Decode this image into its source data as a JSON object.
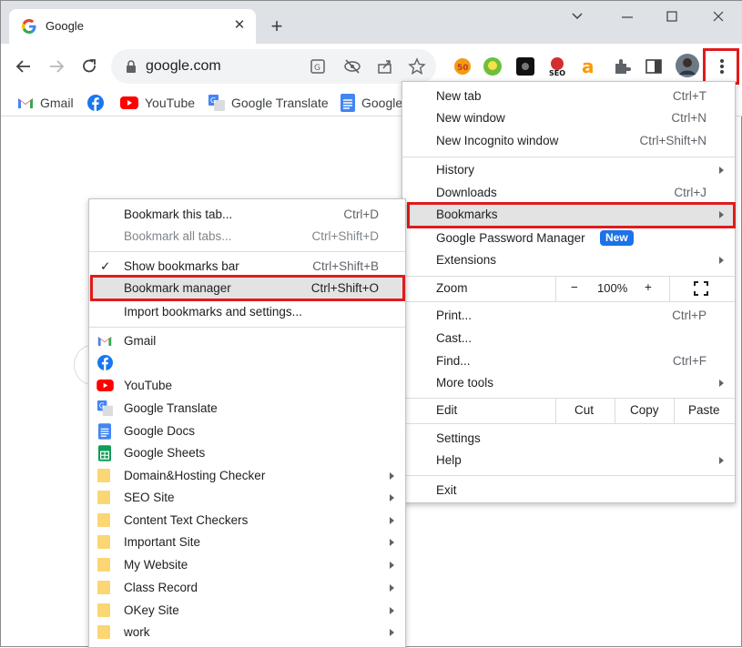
{
  "tab": {
    "title": "Google"
  },
  "omnibox": {
    "url": "google.com"
  },
  "bookmarks_bar": [
    {
      "label": "Gmail",
      "icon": "gmail-icon"
    },
    {
      "label": "",
      "icon": "facebook-icon"
    },
    {
      "label": "YouTube",
      "icon": "youtube-icon"
    },
    {
      "label": "Google Translate",
      "icon": "translate-icon"
    },
    {
      "label": "Google",
      "icon": "docs-icon"
    }
  ],
  "chrome_menu": {
    "new_tab": {
      "label": "New tab",
      "shortcut": "Ctrl+T"
    },
    "new_window": {
      "label": "New window",
      "shortcut": "Ctrl+N"
    },
    "incognito": {
      "label": "New Incognito window",
      "shortcut": "Ctrl+Shift+N"
    },
    "history": {
      "label": "History"
    },
    "downloads": {
      "label": "Downloads",
      "shortcut": "Ctrl+J"
    },
    "bookmarks": {
      "label": "Bookmarks"
    },
    "password_manager": {
      "label": "Google Password Manager",
      "badge": "New"
    },
    "extensions": {
      "label": "Extensions"
    },
    "zoom": {
      "label": "Zoom",
      "minus": "−",
      "level": "100%",
      "plus": "+"
    },
    "print": {
      "label": "Print...",
      "shortcut": "Ctrl+P"
    },
    "cast": {
      "label": "Cast..."
    },
    "find": {
      "label": "Find...",
      "shortcut": "Ctrl+F"
    },
    "more_tools": {
      "label": "More tools"
    },
    "edit": {
      "label": "Edit",
      "cut": "Cut",
      "copy": "Copy",
      "paste": "Paste"
    },
    "settings": {
      "label": "Settings"
    },
    "help": {
      "label": "Help"
    },
    "exit": {
      "label": "Exit"
    }
  },
  "bookmarks_menu": {
    "bookmark_tab": {
      "label": "Bookmark this tab...",
      "shortcut": "Ctrl+D"
    },
    "bookmark_all": {
      "label": "Bookmark all tabs...",
      "shortcut": "Ctrl+Shift+D"
    },
    "show_bar": {
      "label": "Show bookmarks bar",
      "shortcut": "Ctrl+Shift+B",
      "check": "✓"
    },
    "manager": {
      "label": "Bookmark manager",
      "shortcut": "Ctrl+Shift+O"
    },
    "import": {
      "label": "Import bookmarks and settings..."
    },
    "items": [
      {
        "label": "Gmail",
        "icon": "gmail-icon"
      },
      {
        "label": "",
        "icon": "facebook-icon"
      },
      {
        "label": "YouTube",
        "icon": "youtube-icon"
      },
      {
        "label": "Google Translate",
        "icon": "translate-icon"
      },
      {
        "label": "Google Docs",
        "icon": "docs-icon"
      },
      {
        "label": "Google Sheets",
        "icon": "sheets-icon"
      }
    ],
    "folders": [
      {
        "label": "Domain&Hosting Checker"
      },
      {
        "label": "SEO Site"
      },
      {
        "label": "Content Text Checkers"
      },
      {
        "label": "Important Site"
      },
      {
        "label": "My Website"
      },
      {
        "label": "Class Record"
      },
      {
        "label": "OKey Site"
      },
      {
        "label": "work"
      }
    ]
  },
  "colors": {
    "highlight": "#e01b1b",
    "badge": "#1a73e8",
    "folder": "#fbd675",
    "tabstrip": "#dee1e6"
  }
}
